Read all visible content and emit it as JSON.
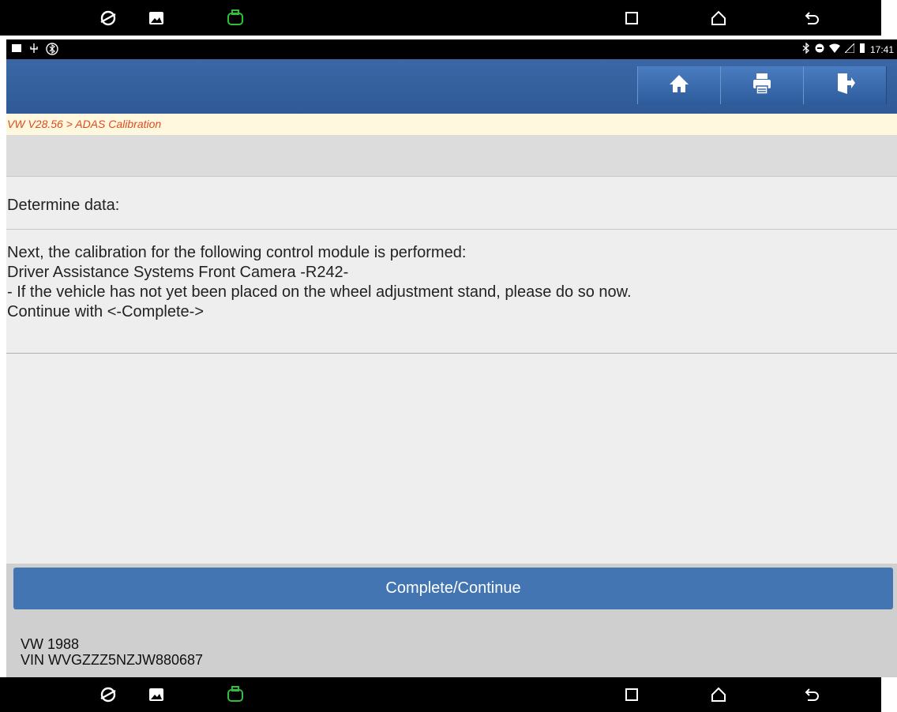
{
  "status_bar": {
    "time": "17:41"
  },
  "breadcrumb": "VW V28.56 > ADAS Calibration",
  "content": {
    "heading": "Determine data:",
    "message_lines": [
      "Next, the calibration for the following control module is performed:",
      "Driver Assistance Systems Front Camera -R242-",
      "- If the vehicle has not yet been placed on the wheel adjustment stand, please do so now.",
      "Continue with <-Complete->"
    ]
  },
  "actions": {
    "complete_label": "Complete/Continue"
  },
  "vehicle": {
    "make_year": "VW 1988",
    "vin": "VIN WVGZZZ5NZJW880687"
  },
  "icons": {
    "nav": [
      "browser-icon",
      "gallery-icon",
      "vci-icon",
      "recent-apps-icon",
      "home-icon",
      "back-icon"
    ],
    "header": [
      "home-icon",
      "print-icon",
      "exit-icon"
    ]
  },
  "colors": {
    "header": "#3b67a6",
    "breadcrumb_text": "#e04a1e",
    "button": "#4475b3",
    "vci": "#2fbf3a"
  }
}
